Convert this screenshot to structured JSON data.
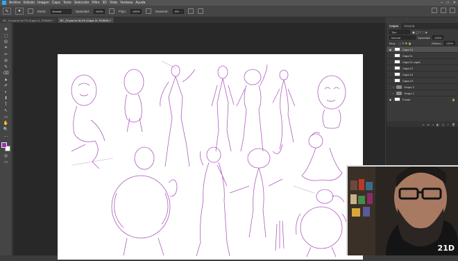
{
  "menu": {
    "items": [
      "Archivo",
      "Edición",
      "Imagen",
      "Capa",
      "Texto",
      "Selección",
      "Filtro",
      "3D",
      "Vista",
      "Ventana",
      "Ayuda"
    ],
    "window_controls": [
      "–",
      "□",
      "✕"
    ]
  },
  "options": {
    "mode_label": "Modo:",
    "mode_value": "Normal",
    "opacity_label": "Opacidad:",
    "opacity_value": "100%",
    "flow_label": "Flujo:",
    "flow_value": "100%",
    "smoothing_label": "Suavizar:",
    "smoothing_value": "0%"
  },
  "tabs": [
    {
      "label": "BC_01.psd al 16,7% (Capa 11, RGB/8*) *",
      "active": false
    },
    {
      "label": "BC_02.psd al 18,4% (Capa 14, RGB/8*) *",
      "active": true
    }
  ],
  "tools": [
    "✥",
    "⬚",
    "ʘ",
    "⌗",
    "✂",
    "⊘",
    "✎",
    "⌫",
    "▲",
    "✐",
    "◐",
    "⬆",
    "T",
    "↖",
    "▭",
    "✋",
    "🔍",
    "…"
  ],
  "colors": {
    "foreground": "#a52cb8",
    "background": "#ffffff",
    "sketch": "#a13fb5"
  },
  "layers_panel": {
    "tabs": [
      "Capas",
      "Historia"
    ],
    "filter_label": "Tipo",
    "blend_mode": "Normal",
    "opacity_label": "Opacidad:",
    "opacity_value": "100%",
    "lock_label": "Bloq.:",
    "fill_label": "Relleno:",
    "fill_value": "100%",
    "layers": [
      {
        "name": "Capa 14",
        "type": "layer",
        "visible": true,
        "active": true
      },
      {
        "name": "Capa 11",
        "type": "layer",
        "visible": false,
        "active": false
      },
      {
        "name": "Capa 11 copia",
        "type": "layer",
        "visible": false,
        "active": false
      },
      {
        "name": "Capa 12",
        "type": "layer",
        "visible": false,
        "active": false
      },
      {
        "name": "Capa 13",
        "type": "layer",
        "visible": false,
        "active": false
      },
      {
        "name": "Capa 10",
        "type": "layer",
        "visible": false,
        "active": false
      },
      {
        "name": "Grupo 2",
        "type": "group",
        "visible": false,
        "active": false
      },
      {
        "name": "Grupo 1",
        "type": "group",
        "visible": false,
        "active": false
      },
      {
        "name": "Fondo",
        "type": "layer",
        "visible": true,
        "active": false,
        "locked": true
      }
    ],
    "footer_icons": [
      "∞",
      "fx",
      "◑",
      "◧",
      "▢",
      "+",
      "🗑"
    ]
  },
  "webcam": {
    "logo": "21D"
  }
}
